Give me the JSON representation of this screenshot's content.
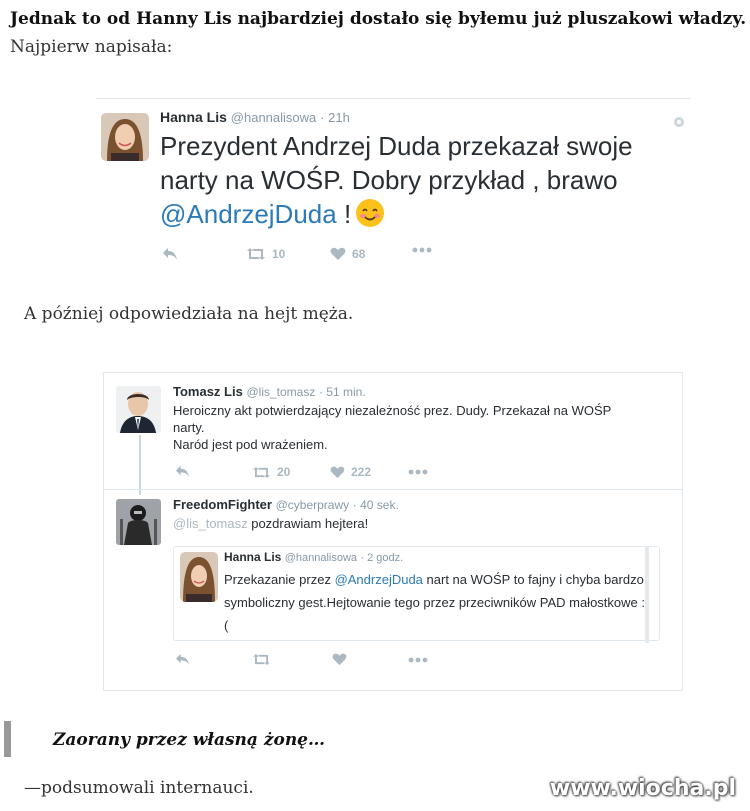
{
  "article": {
    "intro_line1": "Jednak to od Hanny Lis najbardziej dostało się byłemu już pluszakowi władzy.",
    "intro_line2": "Najpierw napisała:",
    "mid_text": "A później odpowiedziała na hejt męża.",
    "quote": "Zaorany przez własną żonę…",
    "closing": "—podsumowali internauci."
  },
  "tweet1": {
    "name": "Hanna Lis",
    "handle": "@hannalisowa",
    "time": "· 21h",
    "text_before": "Prezydent Andrzej Duda przekazał swoje narty na WOŚP. Dobry przykład , brawo ",
    "mention": "@AndrzejDuda",
    "text_after": " !",
    "retweets": "10",
    "likes": "68"
  },
  "tweet2": {
    "name": "Tomasz Lis",
    "handle": "@lis_tomasz",
    "time": "· 51 min.",
    "text_line1": "Heroiczny akt potwierdzający niezależność prez. Dudy. Przekazał na WOŚP",
    "text_line2": "narty.",
    "text_line3": "Naród jest pod wrażeniem.",
    "retweets": "20",
    "likes": "222"
  },
  "reply": {
    "name": "FreedomFighter",
    "handle": "@cyberprawy",
    "time": "· 40 sek.",
    "mention": "@lis_tomasz",
    "text": " pozdrawiam hejtera!"
  },
  "quoted": {
    "name": "Hanna Lis",
    "handle": "@hannalisowa",
    "time": "· 2 godz.",
    "text_before": "Przekazanie przez ",
    "mention": "@AndrzejDuda",
    "text_after": " nart na WOŚP to fajny i chyba bardzo symboliczny gest.Hejtowanie tego przez przeciwników PAD małostkowe : ("
  },
  "watermark": "www.wiocha.pl",
  "colors": {
    "mention": "#2b7bb9",
    "muted": "#8899a6",
    "icon": "#aab8c2"
  }
}
